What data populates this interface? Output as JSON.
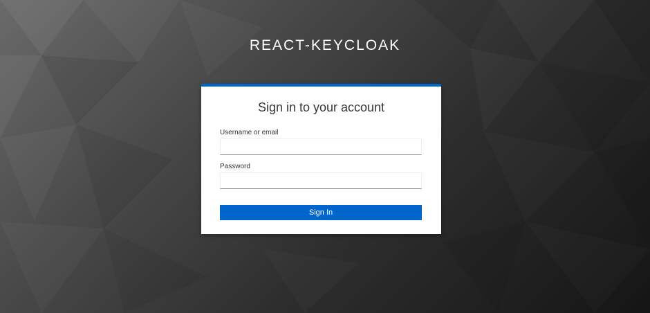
{
  "brand": {
    "title": "REACT-KEYCLOAK"
  },
  "login": {
    "heading": "Sign in to your account",
    "username": {
      "label": "Username or email",
      "value": "",
      "placeholder": ""
    },
    "password": {
      "label": "Password",
      "value": "",
      "placeholder": ""
    },
    "submit_label": "Sign In"
  },
  "colors": {
    "accent": "#0066cc",
    "card_background": "#ffffff",
    "background_dark": "#151515",
    "background_light": "#6a6a6a"
  }
}
